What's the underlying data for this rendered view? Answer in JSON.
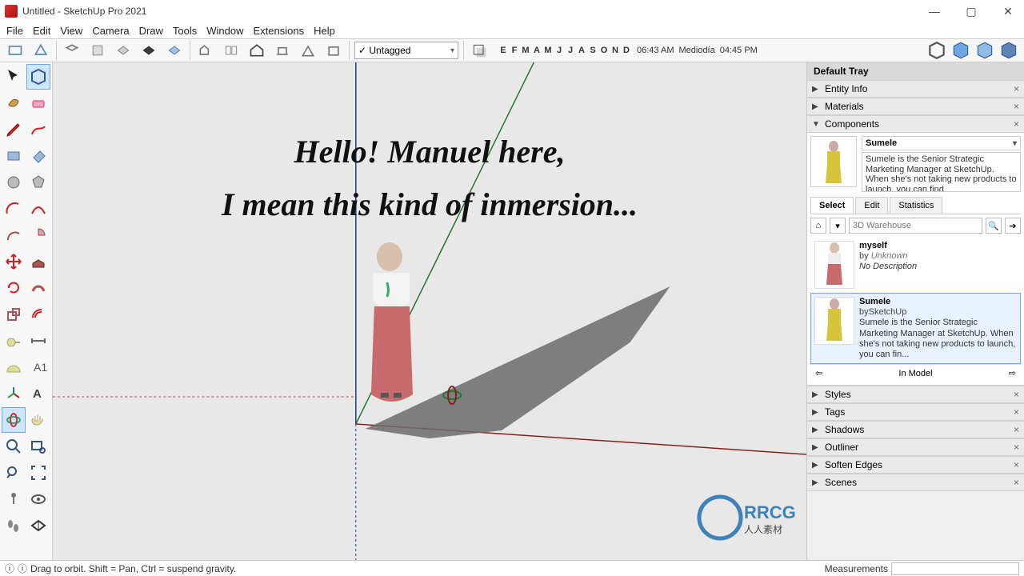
{
  "window": {
    "title": "Untitled - SketchUp Pro 2021"
  },
  "menu": [
    "File",
    "Edit",
    "View",
    "Camera",
    "Draw",
    "Tools",
    "Window",
    "Extensions",
    "Help"
  ],
  "tag_selector": {
    "label": "✓ Untagged"
  },
  "sun": {
    "months": [
      "E",
      "F",
      "M",
      "A",
      "M",
      "J",
      "J",
      "A",
      "S",
      "O",
      "N",
      "D"
    ],
    "time_start": "06:43 AM",
    "noon_label": "Mediodía",
    "time_end": "04:45 PM"
  },
  "viewport_overlay": {
    "line1": "Hello! Manuel here,",
    "line2": "I mean this kind of inmersion..."
  },
  "tray": {
    "title": "Default Tray",
    "panels_above": [
      "Entity Info",
      "Materials"
    ],
    "components": {
      "title": "Components",
      "selected": {
        "name": "Sumele",
        "desc": "Sumele is the Senior Strategic Marketing Manager at SketchUp. When she's not taking new products to launch, you can find"
      },
      "tabs": [
        "Select",
        "Edit",
        "Statistics"
      ],
      "active_tab": "Select",
      "search_placeholder": "3D Warehouse",
      "items": [
        {
          "name": "myself",
          "by_prefix": "by",
          "by": "Unknown",
          "desc": "No Description",
          "selected": false
        },
        {
          "name": "Sumele",
          "by_prefix": "by",
          "by": "SketchUp",
          "desc": "Sumele is the Senior Strategic Marketing Manager at SketchUp. When she's not taking new products to launch, you can fin...",
          "selected": true
        }
      ],
      "nav_label": "In Model"
    },
    "panels_below": [
      "Styles",
      "Tags",
      "Shadows",
      "Outliner",
      "Soften Edges",
      "Scenes"
    ]
  },
  "status": {
    "hint": "Drag to orbit. Shift = Pan, Ctrl = suspend gravity.",
    "measurements_label": "Measurements"
  },
  "watermark": {
    "text": "RRCG",
    "sub": "人人素材"
  }
}
